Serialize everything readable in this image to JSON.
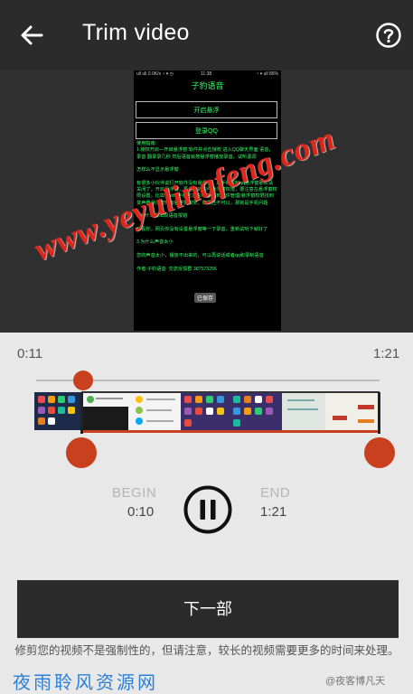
{
  "app_bar": {
    "back_icon": "arrow-back-icon",
    "title": "Trim video",
    "help_icon": "help-circle-icon"
  },
  "preview": {
    "status_left": "ull ull 0.0K/s ◔ ▾ ◷",
    "status_time": "11:38",
    "status_right": "◔ ▾ ull 86%",
    "app_title": "子豹语音",
    "button_open": "开启悬浮",
    "button_qq": "登录QQ",
    "body_text": "使用指南:\n1.授权开启—开启悬浮窗 软件并点击授权 进入QQ聊天界面 语音，录音 翻录录几秒 然后语音就按悬浮窗播放录音，试听源调\n\n怎样么不显示悬浮窗\n\n有很多小伙伴说打开软件没有悬浮窗，是手机限制qq悬浮窗那么请关闭了，开启悬浮窗，再为你的软件悬浮窗权限，要注意在悬浮窗权限设置，比如说vivo手机可以在i管家请到软件管理/悬浮窗权限找到变声器悬浮窗开启悬浮窗权限，如果还不可以，那就是手机问题\n\n2.为什么会出现语音报错\n\n恭喜你，网页你没有设置悬浮窗等一下录音，重新试听下就好了\n\n3.为什么声音太小\n\n您的声音太小，播放不出来的，可以再说话或者qq和录制语音\n\n作者:子豹语音  交流反馈群 387573256",
    "toast": "已保存",
    "watermark": "www.yeyulingfeng.com"
  },
  "trim": {
    "current_time": "0:11",
    "duration": "1:21",
    "begin_label": "BEGIN",
    "begin_value": "0:10",
    "end_label": "END",
    "end_value": "1:21",
    "playhead_position": 0.136,
    "accent_color": "#c8401e"
  },
  "play_pause_icon": "pause-circle-icon",
  "next_button": "下一部",
  "note": "修剪您的视频不是强制性的，但请注意，较长的视频需要更多的时间来处理。",
  "brand_watermark": "夜雨聆风资源网",
  "weibo_watermark": "@夜客博凡天"
}
